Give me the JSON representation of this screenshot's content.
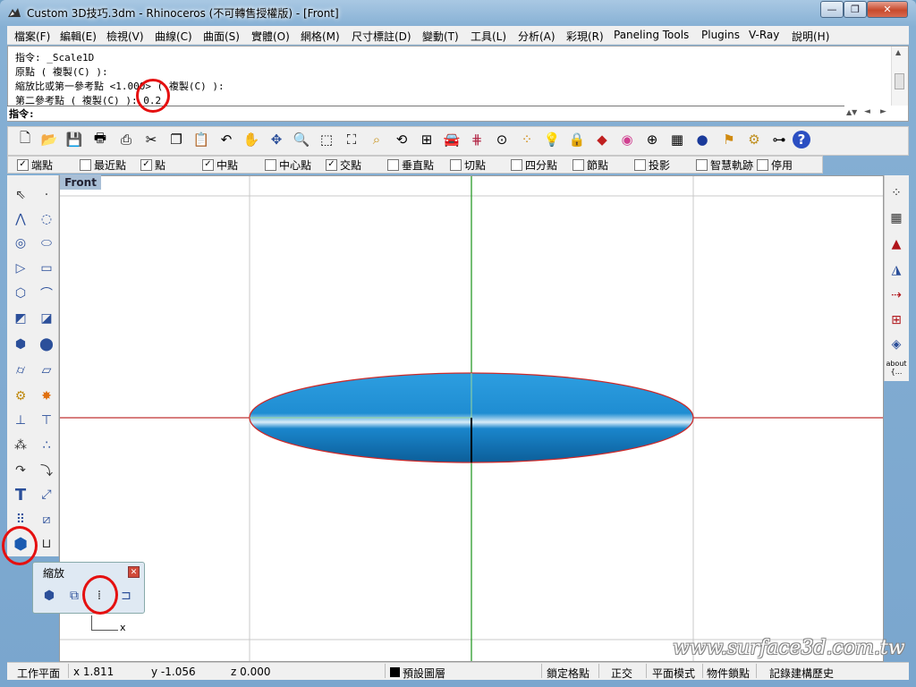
{
  "window": {
    "title": "Custom 3D技巧.3dm - Rhinoceros (不可轉售授權版) - [Front]",
    "min_glyph": "—",
    "max_glyph": "❐",
    "close_glyph": "✕"
  },
  "menu": [
    "檔案(F)",
    "編輯(E)",
    "檢視(V)",
    "曲線(C)",
    "曲面(S)",
    "實體(O)",
    "網格(M)",
    "尺寸標註(D)",
    "變動(T)",
    "工具(L)",
    "分析(A)",
    "彩現(R)",
    "Paneling Tools",
    "Plugins",
    "V-Ray",
    "說明(H)"
  ],
  "command": {
    "history": [
      "指令: _Scale1D",
      "原點 ( 複製(C) ):",
      "縮放比或第一參考點 <1.000> ( 複製(C) ):",
      "第二參考點 ( 複製(C) ): 0.2"
    ],
    "prompt": "指令:"
  },
  "toolbar": [
    "new-icon",
    "open-icon",
    "save-icon",
    "print-icon",
    "import-icon",
    "cut-icon",
    "copy-icon",
    "paste-icon",
    "undo-icon",
    "pan-icon",
    "rotate-view-icon",
    "zoom-dynamic-icon",
    "zoom-window-icon",
    "zoom-extents-icon",
    "zoom-selected-icon",
    "undo-view-icon",
    "four-viewports-icon",
    "car-icon",
    "grid-icon",
    "target-icon",
    "point-icon",
    "light-icon",
    "lock-icon",
    "render-icon",
    "color-icon",
    "sphere-wire-icon",
    "mesh-icon",
    "ball-icon",
    "vray-icon",
    "gear-icon",
    "tree-icon",
    "help-icon"
  ],
  "osnap": [
    {
      "label": "端點",
      "checked": true
    },
    {
      "label": "最近點",
      "checked": false
    },
    {
      "label": "點",
      "checked": true
    },
    {
      "label": "中點",
      "checked": true
    },
    {
      "label": "中心點",
      "checked": false
    },
    {
      "label": "交點",
      "checked": true
    },
    {
      "label": "垂直點",
      "checked": false
    },
    {
      "label": "切點",
      "checked": false
    },
    {
      "label": "四分點",
      "checked": false
    },
    {
      "label": "節點",
      "checked": false
    },
    {
      "label": "投影",
      "checked": false
    },
    {
      "label": "智慧軌跡",
      "checked": false
    },
    {
      "label": "停用",
      "checked": false
    }
  ],
  "viewport": {
    "title": "Front"
  },
  "right_toolbar": {
    "about_label": "about {..."
  },
  "popup": {
    "title": "縮放",
    "close_glyph": "✕",
    "axis_label": "x"
  },
  "status": {
    "cplane": "工作平面",
    "x": "x 1.811",
    "y": "y -1.056",
    "z": "z 0.000",
    "layer": "預設圖層",
    "grid_snap": "鎖定格點",
    "ortho": "正交",
    "planar": "平面模式",
    "osnap": "物件鎖點",
    "history": "記錄建構歷史"
  },
  "watermark": "www.surface3d.com.tw",
  "colors": {
    "accent": "#e51010",
    "ellipse_fill": "#1a8fd6",
    "ellipse_edge": "#cc2a2a",
    "x_axis": "#c03030",
    "y_axis": "#2a9a2a",
    "grid": "#c8c8c8"
  }
}
